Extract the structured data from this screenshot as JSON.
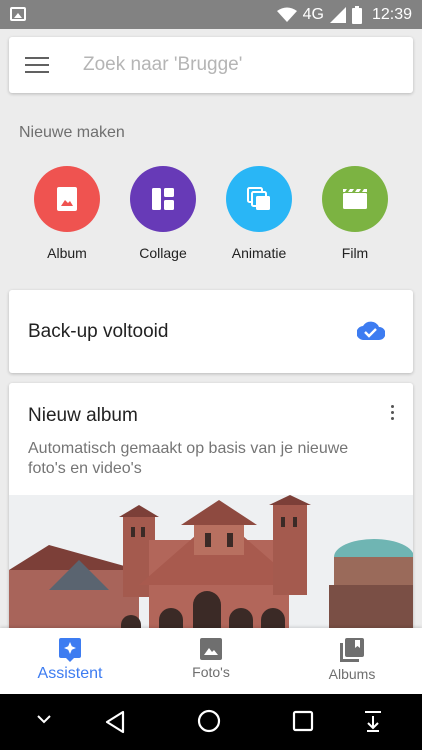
{
  "status_bar": {
    "network": "4G",
    "time": "12:39"
  },
  "search": {
    "placeholder": "Zoek naar 'Brugge'",
    "value": ""
  },
  "create": {
    "title": "Nieuwe maken",
    "items": [
      {
        "label": "Album",
        "icon": "album-icon",
        "color": "#ef5350"
      },
      {
        "label": "Collage",
        "icon": "collage-icon",
        "color": "#673ab7"
      },
      {
        "label": "Animatie",
        "icon": "animation-icon",
        "color": "#29b6f6"
      },
      {
        "label": "Film",
        "icon": "film-icon",
        "color": "#7cb342"
      }
    ]
  },
  "backup": {
    "text": "Back-up voltooid",
    "icon": "cloud-done-icon",
    "color": "#3d7cf1"
  },
  "album_card": {
    "title": "Nieuw album",
    "description": "Automatisch gemaakt op basis van je nieuwe foto's en video's"
  },
  "bottom_nav": {
    "items": [
      {
        "label": "Assistent",
        "icon": "assistant-icon",
        "active": true
      },
      {
        "label": "Foto's",
        "icon": "photos-icon",
        "active": false
      },
      {
        "label": "Albums",
        "icon": "albums-icon",
        "active": false
      }
    ],
    "active_color": "#3d7cf1"
  }
}
